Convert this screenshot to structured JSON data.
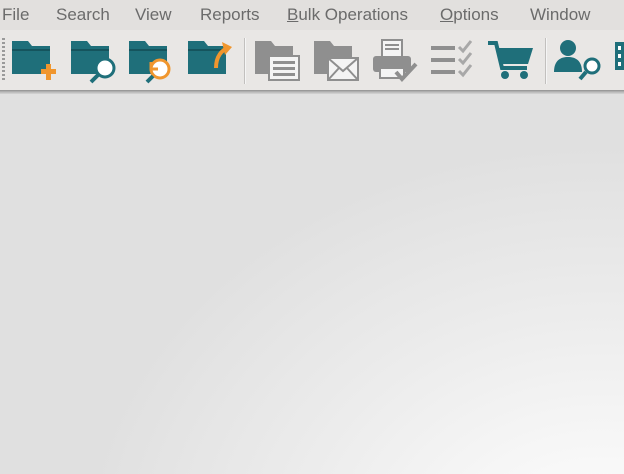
{
  "menu": {
    "file": "File",
    "search": "Search",
    "view": "View",
    "reports": "Reports",
    "bulk_first": "B",
    "bulk_rest": "ulk Operations",
    "options_first": "O",
    "options_rest": "ptions",
    "window": "Window"
  },
  "toolbar": {
    "icons": [
      "new-folder-icon",
      "search-folder-icon",
      "reopen-folder-icon",
      "export-folder-icon",
      "folder-list-icon",
      "folder-mail-icon",
      "printer-check-icon",
      "checklist-icon",
      "shopping-cart-icon",
      "user-search-icon",
      "more-icon"
    ]
  },
  "colors": {
    "teal": "#1f6f7a",
    "orange": "#f0962e",
    "disabled_gray": "#8f8f8f",
    "menu_text": "#6b6b6b"
  }
}
